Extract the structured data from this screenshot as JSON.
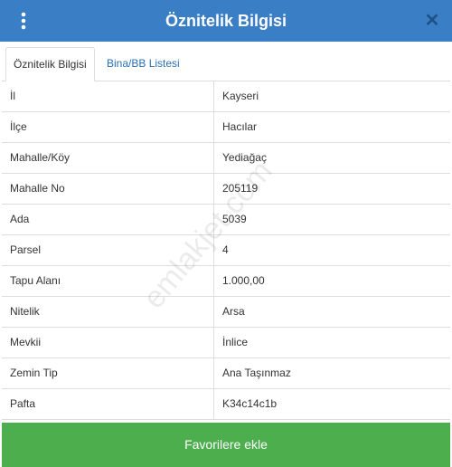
{
  "header": {
    "title": "Öznitelik Bilgisi",
    "close_symbol": "✕",
    "menu_icon": "vertical-ellipsis",
    "background_color": "#3a7fc5"
  },
  "tabs": [
    {
      "label": "Öznitelik Bilgisi",
      "active": true
    },
    {
      "label": "Bina/BB Listesi",
      "active": false
    }
  ],
  "attributes": [
    {
      "label": "İl",
      "value": "Kayseri"
    },
    {
      "label": "İlçe",
      "value": "Hacılar"
    },
    {
      "label": "Mahalle/Köy",
      "value": "Yediağaç"
    },
    {
      "label": "Mahalle No",
      "value": "205119"
    },
    {
      "label": "Ada",
      "value": "5039"
    },
    {
      "label": "Parsel",
      "value": "4"
    },
    {
      "label": "Tapu Alanı",
      "value": "1.000,00"
    },
    {
      "label": "Nitelik",
      "value": "Arsa"
    },
    {
      "label": "Mevkii",
      "value": "İnlice"
    },
    {
      "label": "Zemin Tip",
      "value": "Ana Taşınmaz"
    },
    {
      "label": "Pafta",
      "value": "K34c14c1b"
    }
  ],
  "footer": {
    "favorite_label": "Favorilere ekle",
    "button_color": "#4cae4c"
  },
  "watermark": "emlakjet.com"
}
